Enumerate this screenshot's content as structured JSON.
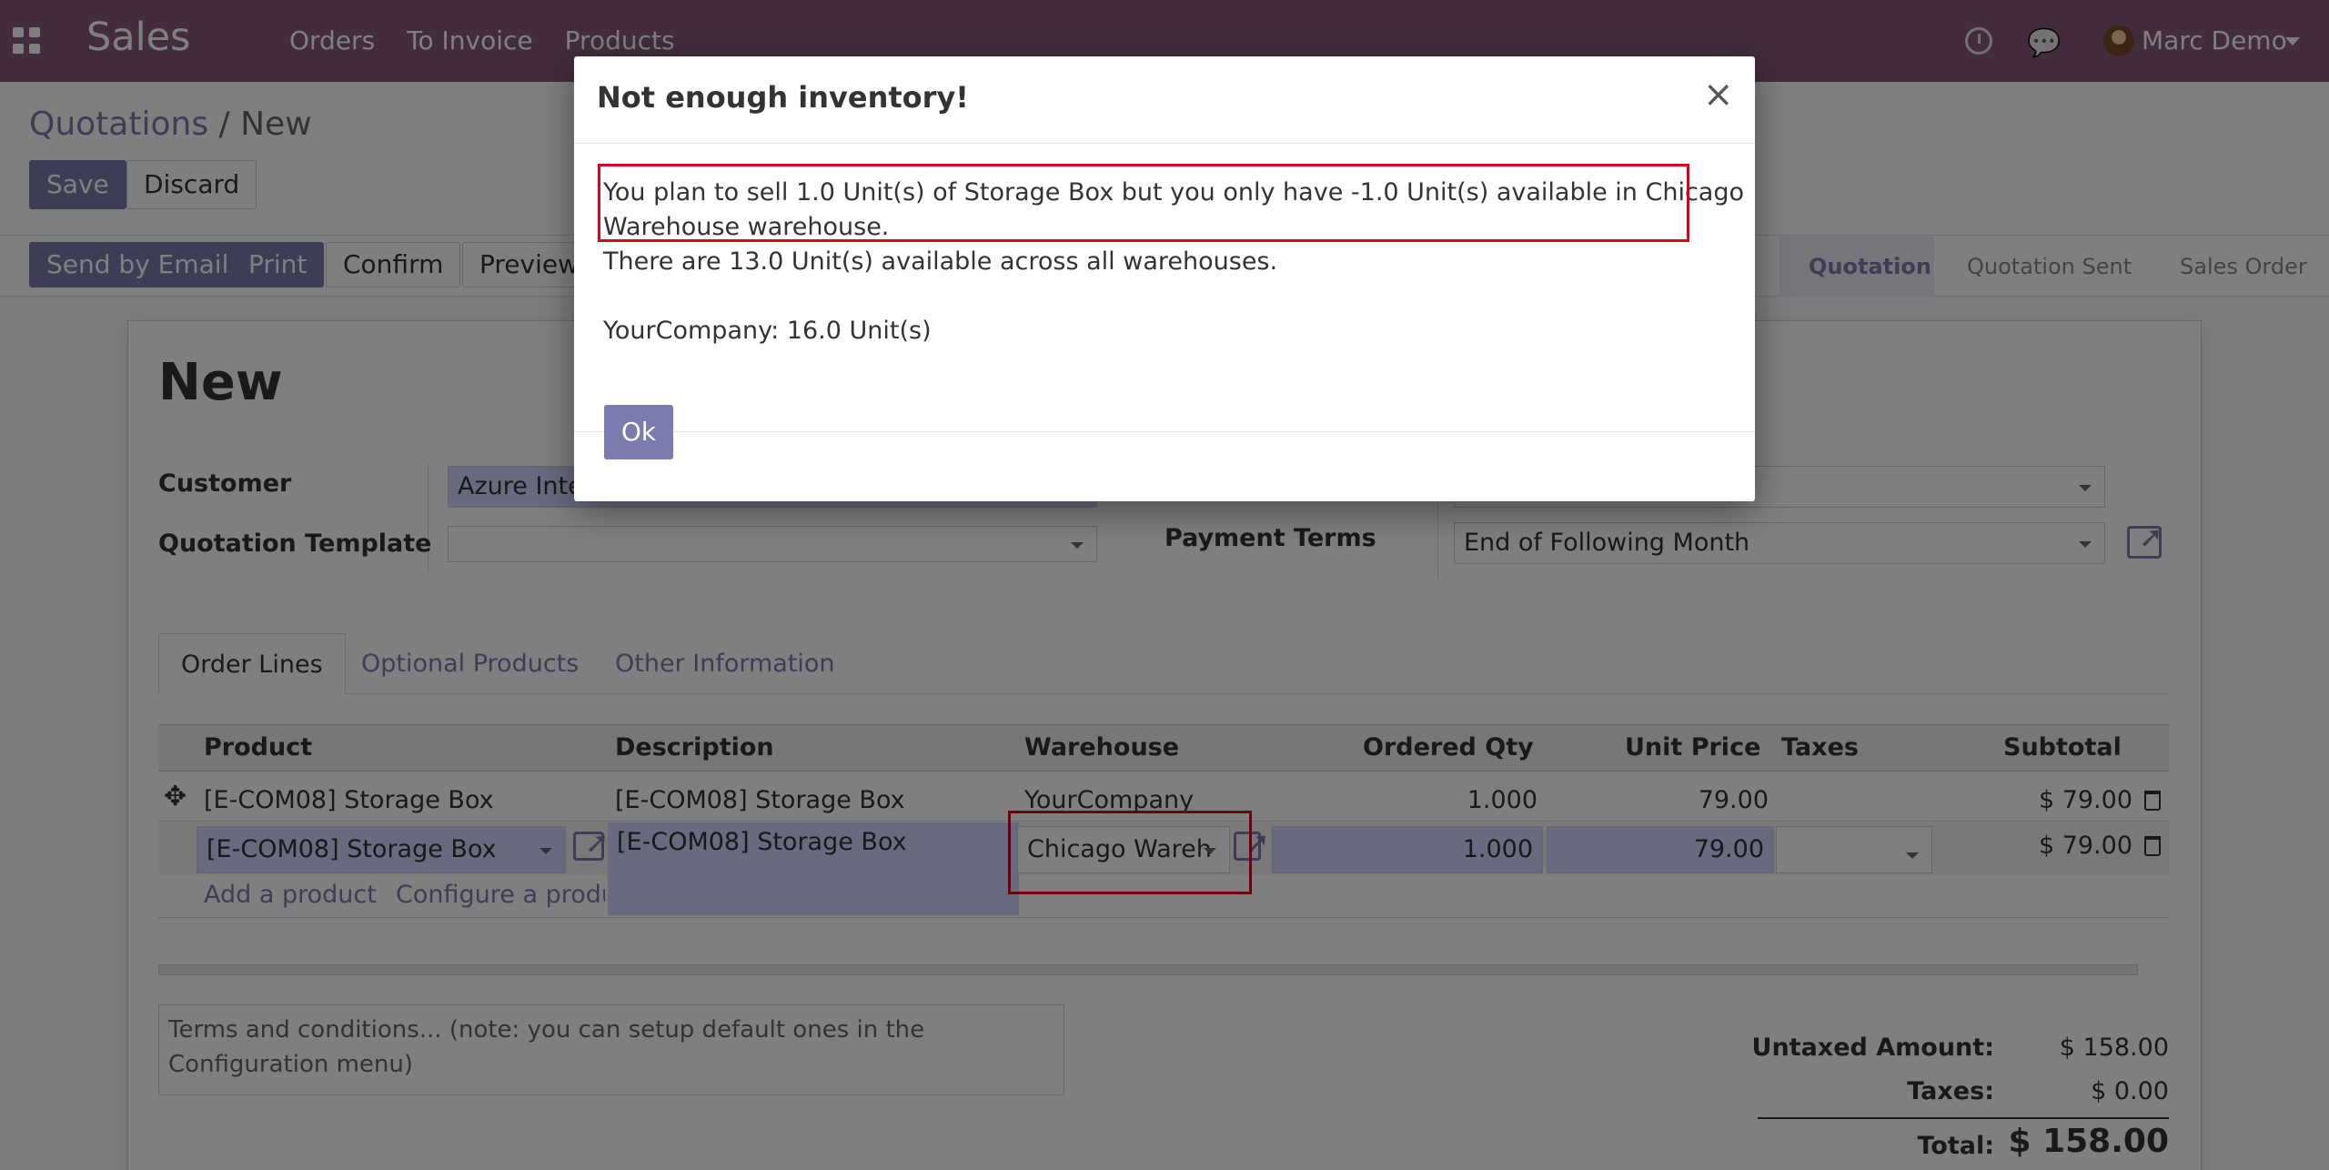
{
  "navbar": {
    "brand": "Sales",
    "menu": [
      "Orders",
      "To Invoice",
      "Products"
    ],
    "user": "Marc Demo"
  },
  "control_panel": {
    "breadcrumb_parent": "Quotations",
    "breadcrumb_sep": "/",
    "breadcrumb_current": "New",
    "save": "Save",
    "discard": "Discard",
    "actions": [
      "Send by Email",
      "Print",
      "Confirm",
      "Preview"
    ],
    "statuses": [
      "Quotation",
      "Quotation Sent",
      "Sales Order"
    ],
    "active_status": "Quotation"
  },
  "form": {
    "title": "New",
    "customer_label": "Customer",
    "customer_value": "Azure Inte",
    "template_label": "Quotation Template",
    "template_value": "",
    "payment_terms_label": "Payment Terms",
    "payment_terms_value": "End of Following Month",
    "tabs": [
      "Order Lines",
      "Optional Products",
      "Other Information"
    ],
    "columns": [
      "Product",
      "Description",
      "Warehouse",
      "Ordered Qty",
      "Unit Price",
      "Taxes",
      "Subtotal"
    ],
    "rows": [
      {
        "product": "[E-COM08] Storage Box",
        "description": "[E-COM08] Storage Box",
        "warehouse": "YourCompany",
        "qty": "1.000",
        "price": "79.00",
        "taxes": "",
        "subtotal": "$ 79.00"
      },
      {
        "product": "[E-COM08] Storage Box",
        "description": "[E-COM08] Storage Box",
        "warehouse": "Chicago Wareh",
        "qty": "1.000",
        "price": "79.00",
        "taxes": "",
        "subtotal": "$ 79.00"
      }
    ],
    "add_product": "Add a product",
    "configure_product": "Configure a produ",
    "terms_placeholder": "Terms and conditions... (note: you can setup default ones in the Configuration menu)",
    "totals": {
      "untaxed_label": "Untaxed Amount:",
      "untaxed_value": "$ 158.00",
      "taxes_label": "Taxes:",
      "taxes_value": "$ 0.00",
      "total_label": "Total:",
      "total_value": "$ 158.00"
    }
  },
  "modal": {
    "title": "Not enough inventory!",
    "close": "×",
    "line1": "You plan to sell 1.0 Unit(s) of Storage Box but you only have -1.0 Unit(s) available in Chicago",
    "line2": "Warehouse warehouse.",
    "line3": "There are 13.0 Unit(s) available across all warehouses.",
    "line4": "YourCompany: 16.0 Unit(s)",
    "ok": "Ok"
  },
  "colors": {
    "brand": "#875a7b",
    "primary": "#7c7bad",
    "highlight": "#e1001a",
    "required_field": "#d2d2ff"
  }
}
